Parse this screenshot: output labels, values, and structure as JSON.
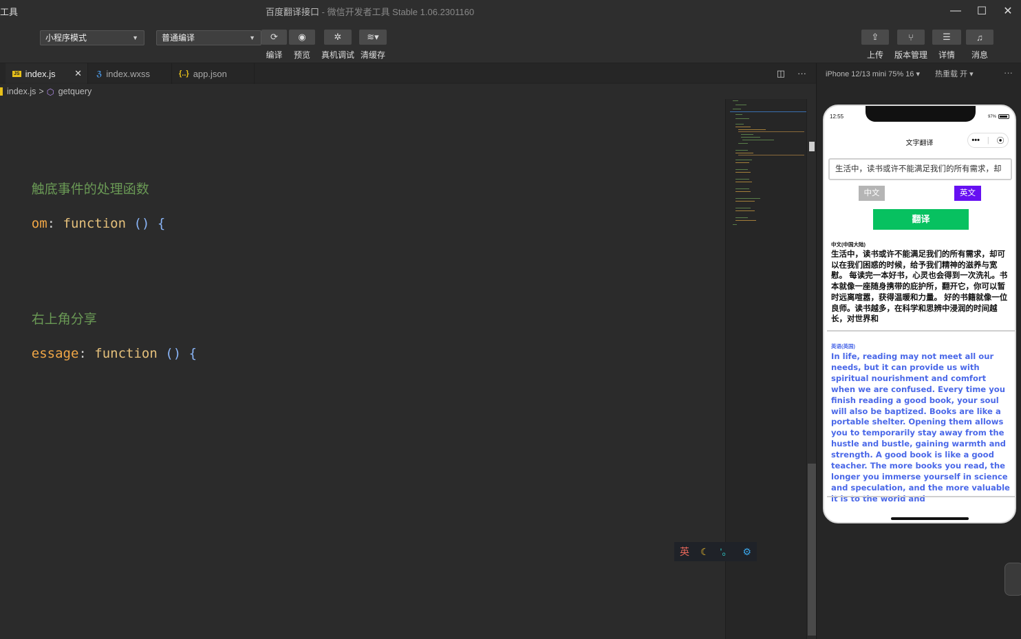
{
  "window": {
    "app_name": "工具",
    "title": "百度翻译接口",
    "subtitle": " - 微信开发者工具 Stable 1.06.2301160",
    "controls": {
      "minimize": "—",
      "maximize": "☐",
      "close": "✕"
    }
  },
  "toolbar": {
    "mode_select": "小程序模式",
    "compile_select": "普通编译",
    "buttons": [
      {
        "label": "编译",
        "icon": "refresh-icon"
      },
      {
        "label": "预览",
        "icon": "eye-icon"
      },
      {
        "label": "真机调试",
        "icon": "bug-icon"
      },
      {
        "label": "清缓存",
        "icon": "layers-icon"
      }
    ],
    "right_buttons": [
      {
        "label": "上传",
        "icon": "upload-icon"
      },
      {
        "label": "版本管理",
        "icon": "branch-icon"
      },
      {
        "label": "详情",
        "icon": "menu-icon"
      },
      {
        "label": "消息",
        "icon": "bell-icon"
      }
    ]
  },
  "tabs": [
    {
      "label": "index.js",
      "type": "JS",
      "active": true
    },
    {
      "label": "index.wxss",
      "type": "css"
    },
    {
      "label": "app.json",
      "type": "{..}"
    }
  ],
  "breadcrumb": {
    "file": "index.js",
    "separator": ">",
    "symbol": "getquery"
  },
  "editor": {
    "lines": [
      {
        "comment": "触底事件的处理函数"
      },
      {
        "prop": "om",
        "colon": ": ",
        "kw": "function",
        "rest": " () {"
      },
      {
        "comment": "右上角分享"
      },
      {
        "prop": "essage",
        "colon": ": ",
        "kw": "function",
        "rest": " () {"
      }
    ]
  },
  "ime": {
    "lang": "英",
    "moon": "☾",
    "punct": "'。",
    "gear": "⚙"
  },
  "simulator": {
    "device": "iPhone 12/13 mini 75% 16 ▾",
    "hot_reload": "热重载 开 ▾",
    "more": "···",
    "status_time": "12:55",
    "battery": "97%",
    "nav_title": "文字翻译",
    "capsule_more": "•••",
    "input_text": "生活中，读书或许不能满足我们的所有需求，却",
    "lang_zh": "中文",
    "lang_en": "英文",
    "translate": "翻译",
    "result_zh_label": "中文(中国大陆)",
    "result_zh": "生活中，读书或许不能满足我们的所有需求，却可以在我们困惑的时候，给予我们精神的滋养与宽慰。 每读完一本好书，心灵也会得到一次洗礼。书本就像一座随身携带的庇护所，翻开它，你可以暂时远离喧嚣，获得温暖和力量。 好的书籍就像一位良师。读书越多，在科学和思辨中浸润的时间越长，对世界和",
    "result_en_label": "英语(英国)",
    "result_en": "In life, reading may not meet all our needs, but it can provide us with spiritual nourishment and comfort when we are confused. Every time you finish reading a good book, your soul will also be baptized. Books are like a portable shelter. Opening them allows you to temporarily stay away from the hustle and bustle, gaining warmth and strength. A good book is like a good teacher. The more books you read, the longer you immerse yourself in science and speculation, and the more valuable it is to the world and"
  },
  "colors": {
    "accent_green": "#07c160",
    "accent_purple": "#6610f2",
    "result_blue": "#4a68e8"
  }
}
